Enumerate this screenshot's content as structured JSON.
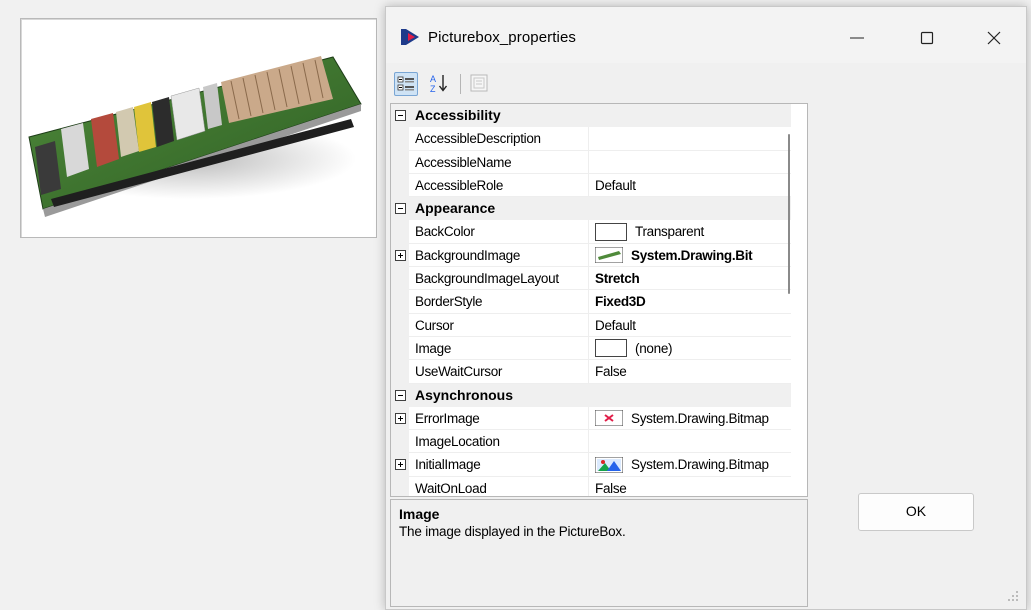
{
  "window": {
    "title": "Picturebox_properties"
  },
  "toolbar": {
    "categorized": "categorized-icon",
    "alphabetical": "sort-az-icon",
    "property_pages": "property-pages-icon"
  },
  "grid": {
    "categories": {
      "accessibility": "Accessibility",
      "appearance": "Appearance",
      "asynchronous": "Asynchronous"
    },
    "rows": {
      "accessible_description": {
        "name": "AccessibleDescription",
        "value": ""
      },
      "accessible_name": {
        "name": "AccessibleName",
        "value": ""
      },
      "accessible_role": {
        "name": "AccessibleRole",
        "value": "Default"
      },
      "back_color": {
        "name": "BackColor",
        "value": "Transparent"
      },
      "background_image": {
        "name": "BackgroundImage",
        "value": "System.Drawing.Bit"
      },
      "background_image_layout": {
        "name": "BackgroundImageLayout",
        "value": "Stretch"
      },
      "border_style": {
        "name": "BorderStyle",
        "value": "Fixed3D"
      },
      "cursor": {
        "name": "Cursor",
        "value": "Default"
      },
      "image": {
        "name": "Image",
        "value": "(none)"
      },
      "use_wait_cursor": {
        "name": "UseWaitCursor",
        "value": "False"
      },
      "error_image": {
        "name": "ErrorImage",
        "value": "System.Drawing.Bitmap"
      },
      "image_location": {
        "name": "ImageLocation",
        "value": ""
      },
      "initial_image": {
        "name": "InitialImage",
        "value": "System.Drawing.Bitmap"
      },
      "wait_on_load": {
        "name": "WaitOnLoad",
        "value": "False"
      }
    }
  },
  "description": {
    "title": "Image",
    "text": "The image displayed in the PictureBox."
  },
  "buttons": {
    "ok": "OK"
  }
}
